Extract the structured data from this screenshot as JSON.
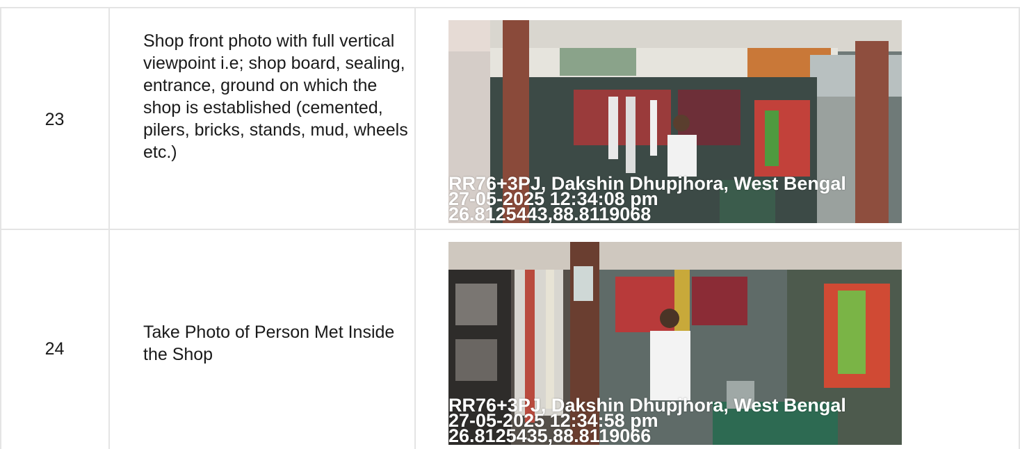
{
  "rows": [
    {
      "number": "23",
      "description": "Shop front photo with full vertical viewpoint i.e; shop board, sealing, entrance, ground on which the shop is established (cemented, pilers, bricks, stands, mud, wheels etc.)",
      "photo": {
        "location": "RR76+3PJ, Dakshin Dhupjhora, West Bengal",
        "datetime": "27-05-2025 12:34:08 pm",
        "coords": "26.8125443,88.8119068"
      }
    },
    {
      "number": "24",
      "description": "Take Photo of Person Met Inside the Shop",
      "photo": {
        "location": "RR76+3PJ, Dakshin Dhupjhora, West Bengal",
        "datetime": "27-05-2025 12:34:58 pm",
        "coords": "26.8125435,88.8119066"
      }
    }
  ]
}
